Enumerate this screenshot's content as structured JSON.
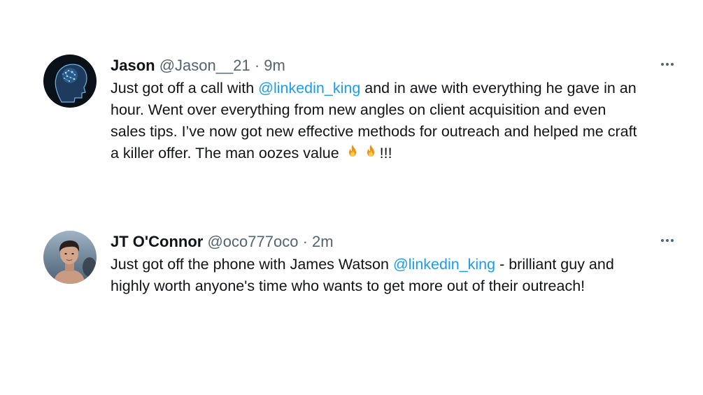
{
  "tweets": [
    {
      "name": "Jason",
      "handle": "@Jason__21",
      "separator": "·",
      "time": "9m",
      "avatar_icon": "brain-head-icon",
      "text_1": "Just got off a call with ",
      "mention": "@linkedin_king",
      "text_2": " and in awe with everything he gave in an hour. Went over everything from new angles on client acquisition and even sales tips. I’ve now got new effective methods for outreach and helped me craft a killer offer. The man oozes value ",
      "emoji": "fire-icon",
      "text_3": "!!!"
    },
    {
      "name": "JT O'Connor",
      "handle": "@oco777oco",
      "separator": "·",
      "time": "2m",
      "avatar_icon": "profile-photo",
      "text_1": "Just got off the phone with James Watson ",
      "mention": "@linkedin_king",
      "text_2": " - brilliant guy and highly worth anyone's time who wants to get more out of their outreach!"
    }
  ],
  "colors": {
    "text": "#0f1419",
    "secondary": "#536471",
    "link": "#1d9bf0"
  }
}
